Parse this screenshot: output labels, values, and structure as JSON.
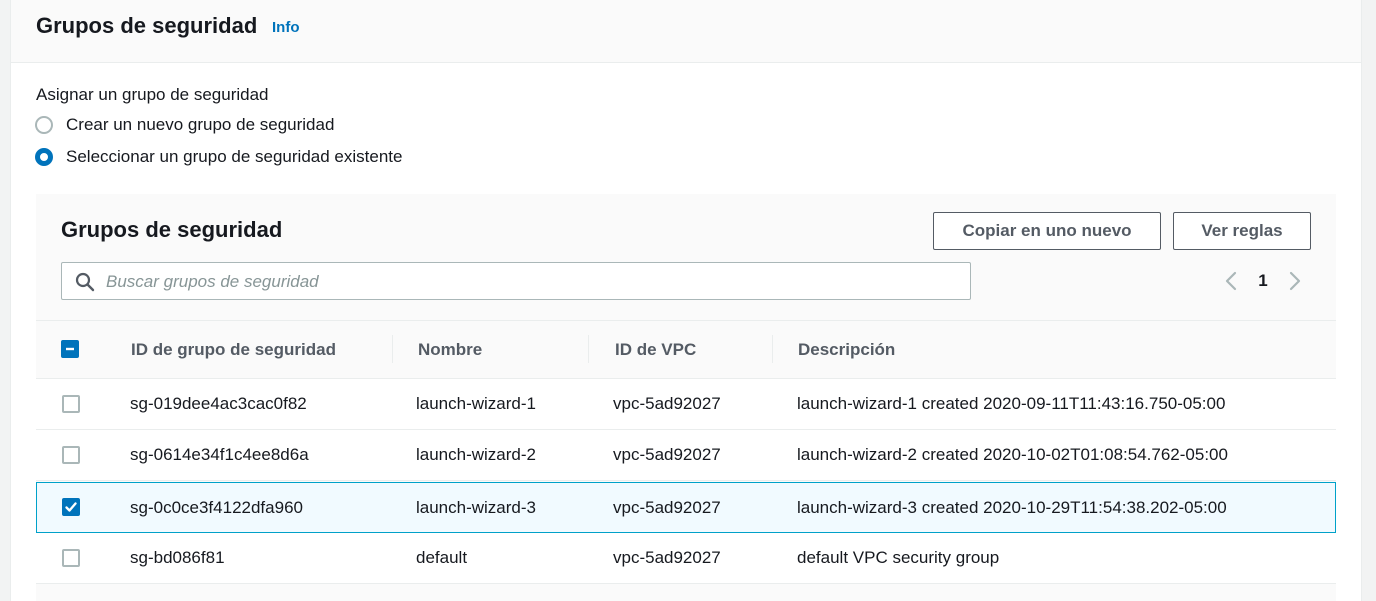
{
  "section": {
    "title": "Grupos de seguridad",
    "info_link": "Info",
    "assign_label": "Asignar un grupo de seguridad",
    "options": [
      {
        "label": "Crear un nuevo grupo de seguridad",
        "selected": false
      },
      {
        "label": "Seleccionar un grupo de seguridad existente",
        "selected": true
      }
    ]
  },
  "table": {
    "title": "Grupos de seguridad",
    "copy_button": "Copiar en uno nuevo",
    "rules_button": "Ver reglas",
    "search": {
      "placeholder": "Buscar grupos de seguridad",
      "value": "",
      "icon": "search-icon"
    },
    "pagination": {
      "current_page": "1"
    },
    "columns": [
      "ID de grupo de seguridad",
      "Nombre",
      "ID de VPC",
      "Descripción"
    ],
    "select_all_state": "indeterminate",
    "rows": [
      {
        "selected": false,
        "id": "sg-019dee4ac3cac0f82",
        "name": "launch-wizard-1",
        "vpc": "vpc-5ad92027",
        "description": "launch-wizard-1 created 2020-09-11T11:43:16.750-05:00"
      },
      {
        "selected": false,
        "id": "sg-0614e34f1c4ee8d6a",
        "name": "launch-wizard-2",
        "vpc": "vpc-5ad92027",
        "description": "launch-wizard-2 created 2020-10-02T01:08:54.762-05:00"
      },
      {
        "selected": true,
        "id": "sg-0c0ce3f4122dfa960",
        "name": "launch-wizard-3",
        "vpc": "vpc-5ad92027",
        "description": "launch-wizard-3 created 2020-10-29T11:54:38.202-05:00"
      },
      {
        "selected": false,
        "id": "sg-bd086f81",
        "name": "default",
        "vpc": "vpc-5ad92027",
        "description": "default VPC security group"
      }
    ]
  },
  "colors": {
    "accent": "#0073bb",
    "selected_row_bg": "#f1faff",
    "selected_row_border": "#00a1c9"
  }
}
